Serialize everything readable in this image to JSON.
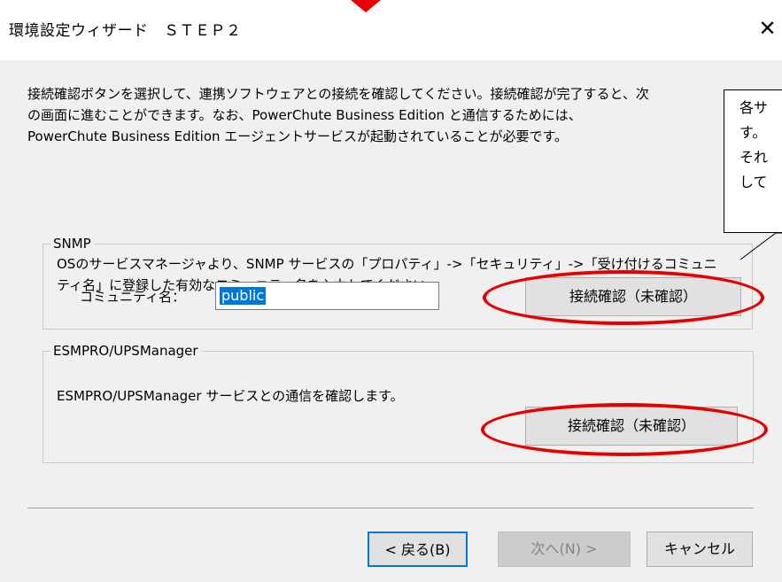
{
  "window": {
    "title": "環境設定ウィザード　ＳＴＥＰ２",
    "close_symbol": "✕"
  },
  "intro": {
    "line1": "接続確認ボタンを選択して、連携ソフトウェアとの接続を確認してください。接続確認が完了すると、次",
    "line2": "の画面に進むことができます。なお、PowerChute Business Edition と通信するためには、",
    "line3": "PowerChute Business Edition エージェントサービスが起動されていることが必要です。"
  },
  "snmp": {
    "group_label": "SNMP",
    "desc_line1": "OSのサービスマネージャより、SNMP サービスの「プロパティ」->「セキュリティ」->「受け付けるコミュニ",
    "desc_line2": "ティ名」に登録した有効なコミュニティ名を入力してください。",
    "community_label": "コミュニティ名：",
    "community_value": "public",
    "connect_button": "接続確認（未確認）"
  },
  "esmpro": {
    "group_label": "ESMPRO/UPSManager",
    "desc": "ESMPRO/UPSManager サービスとの通信を確認します。",
    "connect_button": "接続確認（未確認）"
  },
  "footer": {
    "back_label": "< 戻る(B)",
    "next_label": "次へ(N) >",
    "cancel_label": "キャンセル"
  },
  "callout": {
    "line1": "各サ",
    "line2": "す。",
    "line3": "それ",
    "line4": "して"
  },
  "colors": {
    "annotation_red": "#e60000",
    "selection_blue": "#0078d7",
    "dialog_bg": "#f0f0f0"
  }
}
